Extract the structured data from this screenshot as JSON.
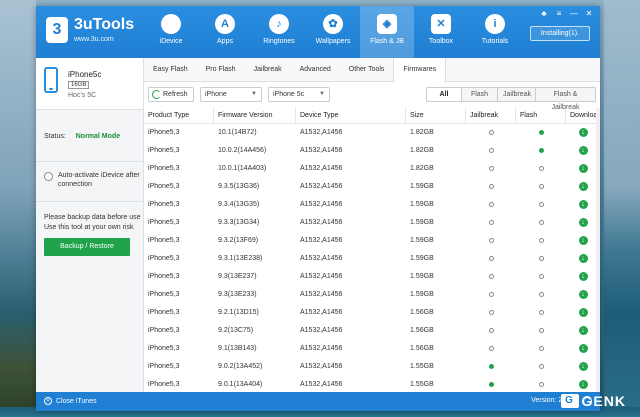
{
  "app": {
    "name": "3uTools",
    "url": "www.3u.com",
    "logo_text": "3",
    "installing_label": "Installing(1)."
  },
  "nav": [
    {
      "label": "iDevice",
      "icon": "apple-icon",
      "glyph": ""
    },
    {
      "label": "Apps",
      "icon": "apps-icon",
      "glyph": "A"
    },
    {
      "label": "Ringtones",
      "icon": "bell-icon",
      "glyph": "♪"
    },
    {
      "label": "Wallpapers",
      "icon": "flower-icon",
      "glyph": "✿"
    },
    {
      "label": "Flash & JB",
      "icon": "box-icon",
      "glyph": "◈"
    },
    {
      "label": "Toolbox",
      "icon": "tools-icon",
      "glyph": "✕"
    },
    {
      "label": "Tutorials",
      "icon": "info-icon",
      "glyph": "i"
    }
  ],
  "window_controls": [
    "♣",
    "≡",
    "—",
    "✕"
  ],
  "device": {
    "name": "iPhone5c",
    "capacity": "16GB",
    "owner": "Hoc's 5C",
    "status_label": "Status:",
    "status_value": "Normal Mode",
    "auto_activate": "Auto-activate iDevice after connection",
    "backup_note": "Please backup data before use Use this tool at your own risk",
    "backup_button": "Backup / Restore"
  },
  "subtabs": [
    "Easy Flash",
    "Pro Flash",
    "Jailbreak",
    "Advanced",
    "Other Tools",
    "Firmwares"
  ],
  "toolbar": {
    "refresh": "Refresh",
    "device_select": "iPhone",
    "model_select": "iPhone 5c",
    "filters": [
      "All",
      "Flash",
      "Jailbreak",
      "Flash & Jailbreak"
    ]
  },
  "table": {
    "headers": [
      "Product Type",
      "Firmware Version",
      "Device Type",
      "Size",
      "Jailbreak",
      "Flash",
      "Download"
    ],
    "rows": [
      {
        "type": "iPhone5,3",
        "version": "10.1(14B72)",
        "device": "A1532,A1456",
        "size": "1.82GB",
        "jailbreak": false,
        "flash": true
      },
      {
        "type": "iPhone5,3",
        "version": "10.0.2(14A456)",
        "device": "A1532,A1456",
        "size": "1.82GB",
        "jailbreak": false,
        "flash": true
      },
      {
        "type": "iPhone5,3",
        "version": "10.0.1(14A403)",
        "device": "A1532,A1456",
        "size": "1.82GB",
        "jailbreak": false,
        "flash": false
      },
      {
        "type": "iPhone5,3",
        "version": "9.3.5(13G36)",
        "device": "A1532,A1456",
        "size": "1.59GB",
        "jailbreak": false,
        "flash": false
      },
      {
        "type": "iPhone5,3",
        "version": "9.3.4(13G35)",
        "device": "A1532,A1456",
        "size": "1.59GB",
        "jailbreak": false,
        "flash": false
      },
      {
        "type": "iPhone5,3",
        "version": "9.3.3(13G34)",
        "device": "A1532,A1456",
        "size": "1.59GB",
        "jailbreak": false,
        "flash": false
      },
      {
        "type": "iPhone5,3",
        "version": "9.3.2(13F69)",
        "device": "A1532,A1456",
        "size": "1.59GB",
        "jailbreak": false,
        "flash": false
      },
      {
        "type": "iPhone5,3",
        "version": "9.3.1(13E238)",
        "device": "A1532,A1456",
        "size": "1.59GB",
        "jailbreak": false,
        "flash": false
      },
      {
        "type": "iPhone5,3",
        "version": "9.3(13E237)",
        "device": "A1532,A1456",
        "size": "1.59GB",
        "jailbreak": false,
        "flash": false
      },
      {
        "type": "iPhone5,3",
        "version": "9.3(13E233)",
        "device": "A1532,A1456",
        "size": "1.59GB",
        "jailbreak": false,
        "flash": false
      },
      {
        "type": "iPhone5,3",
        "version": "9.2.1(13D15)",
        "device": "A1532,A1456",
        "size": "1.56GB",
        "jailbreak": false,
        "flash": false
      },
      {
        "type": "iPhone5,3",
        "version": "9.2(13C75)",
        "device": "A1532,A1456",
        "size": "1.56GB",
        "jailbreak": false,
        "flash": false
      },
      {
        "type": "iPhone5,3",
        "version": "9.1(13B143)",
        "device": "A1532,A1456",
        "size": "1.56GB",
        "jailbreak": false,
        "flash": false
      },
      {
        "type": "iPhone5,3",
        "version": "9.0.2(13A452)",
        "device": "A1532,A1456",
        "size": "1.55GB",
        "jailbreak": true,
        "flash": false
      },
      {
        "type": "iPhone5,3",
        "version": "9.0.1(13A404)",
        "device": "A1532,A1456",
        "size": "1.55GB",
        "jailbreak": true,
        "flash": false
      }
    ]
  },
  "footer": {
    "close_itunes": "Close iTunes",
    "version": "Version: 2.02"
  },
  "watermark": {
    "badge": "G",
    "text": "GENK"
  },
  "colors": {
    "brand_blue": "#1f7fd3",
    "accent_green": "#20a34a"
  }
}
